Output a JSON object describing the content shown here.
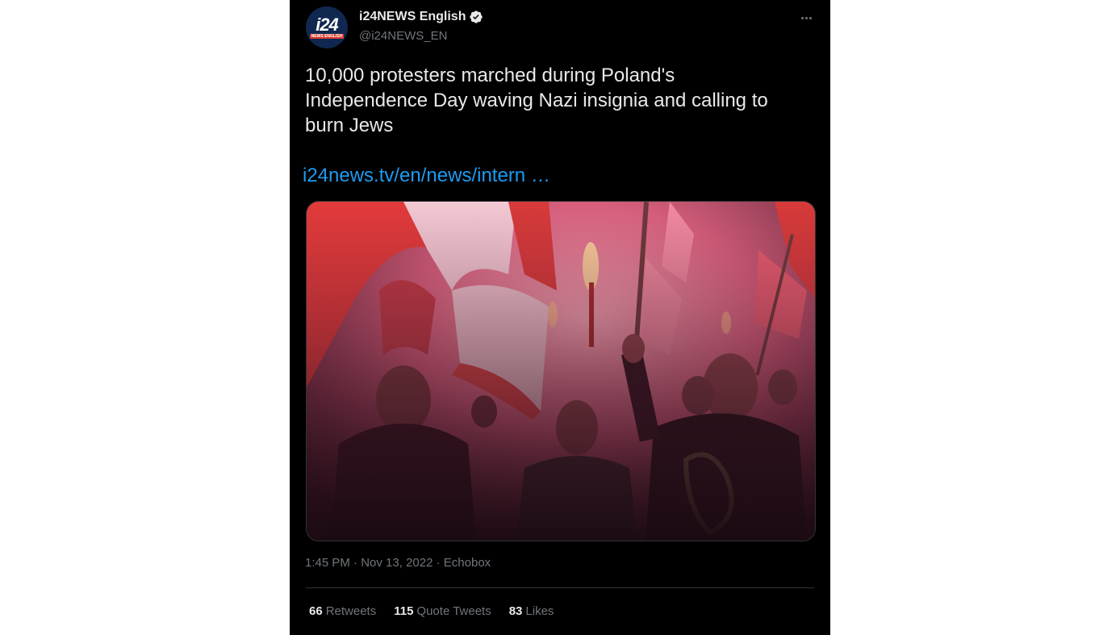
{
  "tweet": {
    "avatar_text": "i24",
    "avatar_sub": "NEWS ENGLISH",
    "display_name": "i24NEWS English",
    "handle": "@i24NEWS_EN",
    "text": "10,000 protesters marched during Poland's\nIndependence Day waving Nazi insignia and calling to\nburn Jews",
    "link_text": "i24news.tv/en/news/intern …",
    "time": "1:45 PM",
    "date": "Nov 13, 2022",
    "source": "Echobox",
    "separator": "·",
    "colors": {
      "background": "#000000",
      "text": "#e7e9ea",
      "muted": "#71767b",
      "link": "#1d9bf0",
      "verified": "#e7e9ea"
    }
  },
  "stats": {
    "retweets_count": "66",
    "retweets_label": "Retweets",
    "quote_count": "115",
    "quote_label": "Quote Tweets",
    "likes_count": "83",
    "likes_label": "Likes"
  },
  "icons": [
    "verified-icon",
    "more-icon"
  ]
}
